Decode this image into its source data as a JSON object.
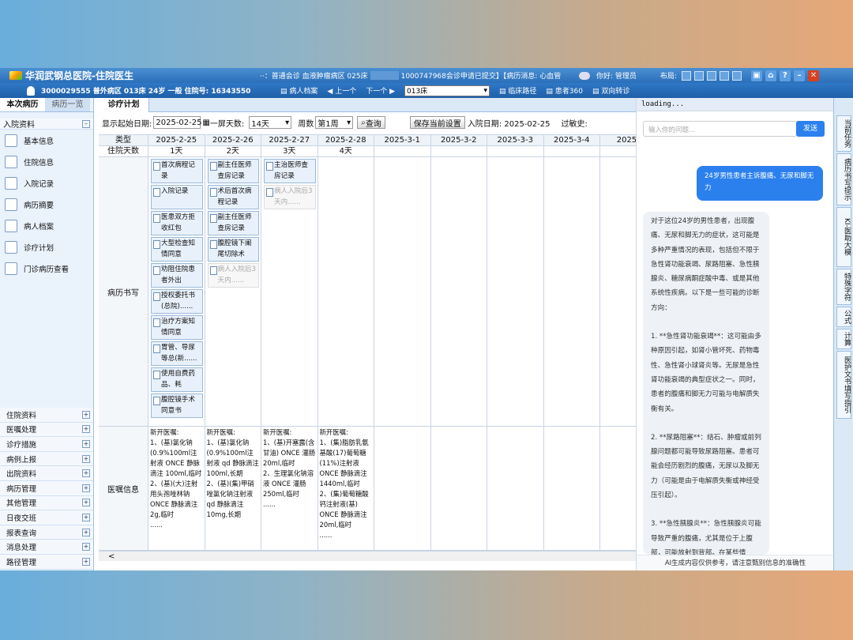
{
  "titlebar": {
    "app_name": "华润武钢总医院-住院医生",
    "notice": "··：普通会诊 血液肿瘤病区 025床",
    "notice2": "1000747968会诊申请已提交】【病历消息: 心血管",
    "user": "你好: 管理员",
    "layout_label": "布局:"
  },
  "infobar": {
    "patient": "3000029555 普外病区 013床 24岁 一般 住院号: 16343550",
    "records": "病人档案",
    "prev": "上一个",
    "next": "下一个",
    "bed_select": "013床",
    "clinical_path": "临床路径",
    "patient360": "患者360",
    "referral": "双向转诊"
  },
  "left": {
    "tabs": [
      "本次病历",
      "病历一览"
    ],
    "header": "入院资料",
    "items": [
      {
        "label": "基本信息",
        "icon": "id-card-icon"
      },
      {
        "label": "住院信息",
        "icon": "building-icon"
      },
      {
        "label": "入院记录",
        "icon": "admission-icon"
      },
      {
        "label": "病历摘要",
        "icon": "summary-icon"
      },
      {
        "label": "病人档案",
        "icon": "folder-icon"
      },
      {
        "label": "诊疗计划",
        "icon": "doctor-icon"
      },
      {
        "label": "门诊病历查看",
        "icon": "clinic-icon"
      }
    ],
    "groups": [
      "住院资料",
      "医嘱处理",
      "诊疗措施",
      "病例上报",
      "出院资料",
      "病历管理",
      "其他管理",
      "日夜交班",
      "报表查询",
      "消息处理",
      "路径管理"
    ]
  },
  "center": {
    "tab": "诊疗计划",
    "toolbar": {
      "start_label": "显示起始日期:",
      "start_date": "2025-02-25",
      "days_label": "一屏天数:",
      "days": "14天",
      "week_label": "周数",
      "week": "第1周",
      "query": "查询",
      "save": "保存当前设置",
      "admit_label": "入院日期: 2025-02-25",
      "allergy": "过敏史:"
    },
    "header": {
      "type": "类型",
      "dates": [
        "2025-2-25",
        "2025-2-26",
        "2025-2-27",
        "2025-2-28",
        "2025-3-1",
        "2025-3-2",
        "2025-3-3",
        "2025-3-4",
        "2025-"
      ]
    },
    "days_row": {
      "label": "住院天数",
      "days": [
        "1天",
        "2天",
        "3天",
        "4天"
      ]
    },
    "rows": {
      "records_label": "病历书写",
      "orders_label": "医嘱信息"
    },
    "records": [
      [
        {
          "t": "首次病程记录",
          "g": false
        },
        {
          "t": "入院记录",
          "g": false
        },
        {
          "t": "医患双方拒收红包协......",
          "g": false
        },
        {
          "t": "大型检查知情同意书......",
          "g": false
        },
        {
          "t": "劝阻住院患者外出告......",
          "g": false
        },
        {
          "t": "授权委托书(总院)......",
          "g": false
        },
        {
          "t": "治疗方案知情同意书......",
          "g": false
        },
        {
          "t": "胃管、导尿等总(新......",
          "g": false
        },
        {
          "t": "使用自费药品、耗材......",
          "g": false
        },
        {
          "t": "腹腔镜手术同意书总......",
          "g": false
        }
      ],
      [
        {
          "t": "副主任医师查房记录",
          "g": false
        },
        {
          "t": "术后首次病程记录",
          "g": false
        },
        {
          "t": "副主任医师查房记录",
          "g": false
        },
        {
          "t": "腹腔镜下阑尾切除术",
          "g": false
        },
        {
          "t": "病人入院后3天内......",
          "g": true
        }
      ],
      [
        {
          "t": "主治医师查房记录",
          "g": false
        },
        {
          "t": "病人入院后3天内......",
          "g": true
        }
      ],
      [],
      [],
      [],
      [],
      [],
      []
    ],
    "orders": [
      "新开医嘱:\n1、(基)氯化钠(0.9%100ml注射液 ONCE 静脉滴注 100ml,临时\n2、(基)(大)注射用头孢唑林钠 ONCE 静脉滴注 2g,临时\n......",
      "新开医嘱:\n1、(基)氯化钠(0.9%100ml注射液 qd 静脉滴注 100ml,长期\n2、(基)(集)甲硝唑氯化钠注射液 qd 静脉滴注 10mg,长期",
      "新开医嘱:\n1、(基)开塞露(含甘油) ONCE 灌肠 20ml,临时\n2、生理氯化钠溶液 ONCE 灌肠 250ml,临时\n......",
      "新开医嘱:\n1、(集)脂肪乳氨基酸(17)葡萄糖(11%)注射液 ONCE 静脉滴注 1440ml,临时\n2、(集)葡萄糖酸钙注射液(基) ONCE 静脉滴注 20ml,临时\n......",
      "",
      "",
      "",
      "",
      ""
    ]
  },
  "ai": {
    "loading": "loading...",
    "placeholder": "输入你的问题...",
    "send": "发送",
    "user_msg": "24岁男性患者主诉腹痛、无尿和脚无力",
    "reply": [
      "对于这位24岁的男性患者，出现腹痛、无尿和脚无力的症状，这可能是多种严重情况的表现，包括但不限于急性肾功能衰竭、尿路阻塞、急性胰腺炎、糖尿病酮症酸中毒、或是其他系统性疾病。以下是一些可能的诊断方向：",
      "1. **急性肾功能衰竭**：这可能由多种原因引起，如肾小管坏死、药物毒性、急性肾小球肾炎等。无尿是急性肾功能衰竭的典型症状之一。同时，患者的腹痛和脚无力可能与电解质失衡有关。",
      "2. **尿路阻塞**：结石、肿瘤或前列腺问题都可能导致尿路阻塞。患者可能会经历剧烈的腹痛，无尿以及脚无力（可能是由于电解质失衡或神经受压引起）。",
      "3. **急性胰腺炎**：急性胰腺炎可能导致严重的腹痛，尤其是位于上腹部，可能放射到背部。在某些情"
    ],
    "footer": "AI生成内容仅供参考，请注意甄别信息的准确性"
  },
  "side_tabs": [
    "当前任务",
    "病历书写提示",
    "KI-医助大模",
    "特殊字符",
    "公式",
    "计算",
    "医护文书填写指引"
  ]
}
